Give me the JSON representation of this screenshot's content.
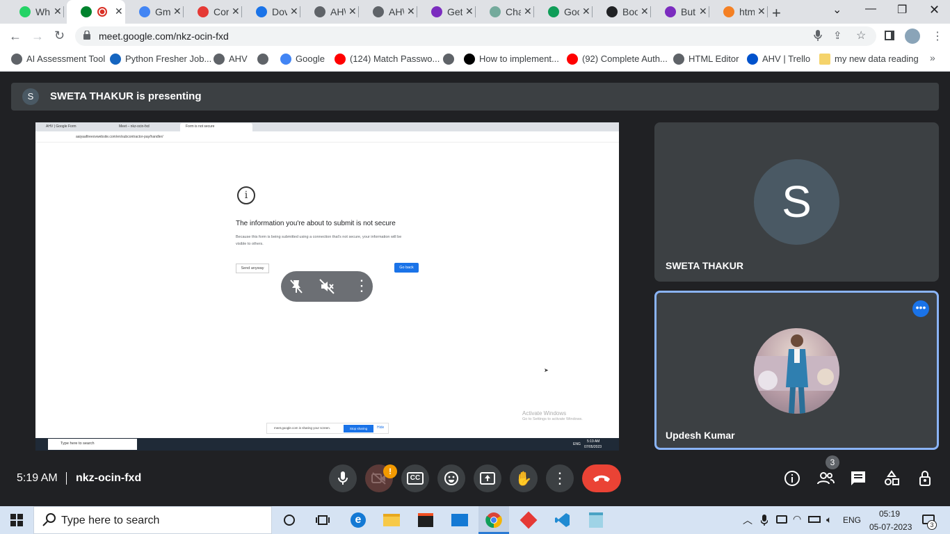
{
  "browser": {
    "tabs": [
      {
        "label": "Wh",
        "color": "#25d366",
        "icon": "whatsapp-icon"
      },
      {
        "label": "",
        "color": "#00832d",
        "icon": "meet-icon",
        "active": true
      },
      {
        "label": "Gm",
        "color": "#4285f4",
        "icon": "google-icon"
      },
      {
        "label": "Cor",
        "color": "#e53935",
        "icon": "airtel-icon"
      },
      {
        "label": "Dov",
        "color": "#1a73e8",
        "icon": "download-icon"
      },
      {
        "label": "AH\\",
        "color": "#5f6368",
        "icon": "globe-icon"
      },
      {
        "label": "AH\\",
        "color": "#5f6368",
        "icon": "globe-icon"
      },
      {
        "label": "Get",
        "color": "#7b2cbf",
        "icon": "bootstrap-icon"
      },
      {
        "label": "Cha",
        "color": "#74aa9c",
        "icon": "chatgpt-icon"
      },
      {
        "label": "Goo",
        "color": "#0f9d58",
        "icon": "meet-icon"
      },
      {
        "label": "Boo",
        "color": "#202124",
        "icon": "codepen-icon"
      },
      {
        "label": "But",
        "color": "#7b2cbf",
        "icon": "bootstrap-icon"
      },
      {
        "label": "htm",
        "color": "#f48024",
        "icon": "stackoverflow-icon"
      }
    ],
    "url": "meet.google.com/nkz-ocin-fxd",
    "bookmarks": [
      {
        "label": "AI Assessment Tool",
        "icon": "globe-icon",
        "color": "#5f6368"
      },
      {
        "label": "Python Fresher Job...",
        "icon": "info-icon",
        "color": "#1565c0"
      },
      {
        "label": "AHV",
        "icon": "globe-icon",
        "color": "#5f6368"
      },
      {
        "label": "",
        "icon": "globe-icon",
        "color": "#5f6368"
      },
      {
        "label": "Google",
        "icon": "google-icon",
        "color": "#4285f4"
      },
      {
        "label": "(124) Match Passwo...",
        "icon": "youtube-icon",
        "color": "#ff0000"
      },
      {
        "label": "",
        "icon": "globe-icon",
        "color": "#5f6368"
      },
      {
        "label": "How to implement...",
        "icon": "medium-icon",
        "color": "#000000"
      },
      {
        "label": "(92) Complete Auth...",
        "icon": "youtube-icon",
        "color": "#ff0000"
      },
      {
        "label": "HTML Editor",
        "icon": "globe-icon",
        "color": "#5f6368"
      },
      {
        "label": "AHV | Trello",
        "icon": "trello-icon",
        "color": "#0052cc"
      },
      {
        "label": "my new data reading",
        "icon": "folder-icon",
        "color": "#f5d36b"
      }
    ]
  },
  "meet": {
    "presenting_label": "SWETA THAKUR is presenting",
    "presenter_initial": "S",
    "participants": [
      {
        "name": "SWETA THAKUR",
        "initial": "S"
      },
      {
        "name": "Updesh Kumar"
      }
    ],
    "time": "5:19 AM",
    "meeting_code": "nkz-ocin-fxd",
    "people_count": "3",
    "cam_alert": "!",
    "shared_screen": {
      "tabs": [
        "AHV | Google Form",
        "Meet – nkz-ocin-fxd",
        "Form is not secure"
      ],
      "url": "aaiyaaftreeovwebsite.com/en/subcontractor-pay/handler/",
      "warning_title": "The information you're about to submit is not secure",
      "warning_body": "Because this form is being submitted using a connection that's not secure, your information will be visible to others.",
      "send_anyway": "Send anyway",
      "go_back": "Go back",
      "activate_title": "Activate Windows",
      "activate_sub": "Go to Settings to activate Windows.",
      "sharing_text": "meet.google.com is sharing your screen.",
      "stop_sharing": "Stop sharing",
      "hide": "Hide",
      "taskbar_search": "Type here to search",
      "tray_lang": "ENG",
      "tray_time": "5:19 AM",
      "tray_date": "07/05/2023"
    }
  },
  "taskbar": {
    "search_placeholder": "Type here to search",
    "lang": "ENG",
    "time": "05:19",
    "date": "05-07-2023",
    "notif_count": "3"
  },
  "colors": {
    "meet_bg": "#202124",
    "tile_bg": "#3c4043",
    "end_call": "#ea4335",
    "active_border": "#8ab4f8",
    "accent_blue": "#1a73e8"
  }
}
